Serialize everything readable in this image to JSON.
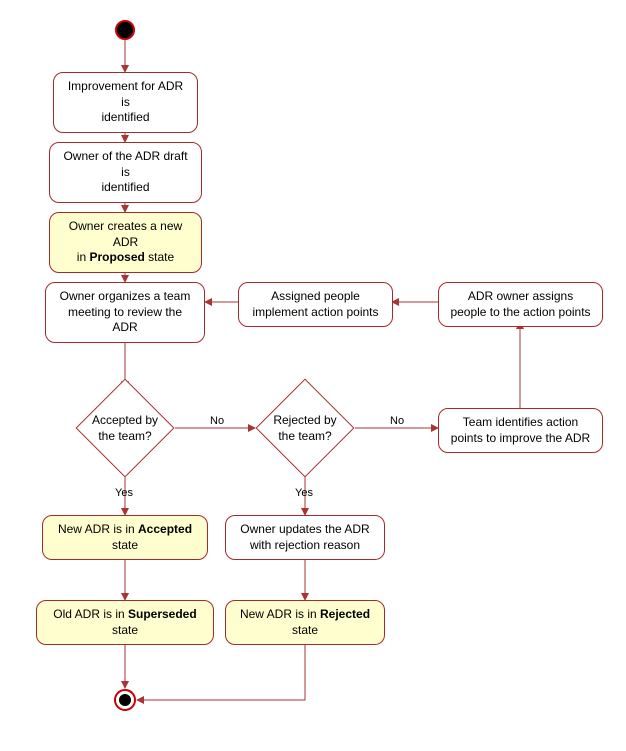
{
  "diagram": {
    "type": "activity",
    "start": true,
    "end": true,
    "nodes": {
      "n1": {
        "text_pre": "Improvement for ADR is",
        "text_post": "identified"
      },
      "n2": {
        "text_pre": "Owner of the ADR draft is",
        "text_post": "identified"
      },
      "n3": {
        "pre": "Owner creates a new ADR",
        "mid_pre": "in ",
        "bold": "Proposed",
        "mid_post": " state"
      },
      "n4": {
        "text_pre": "Owner organizes a team",
        "text_post": "meeting to review the ADR"
      },
      "d1": {
        "line1": "Accepted by",
        "line2": "the team?"
      },
      "d2": {
        "line1": "Rejected by",
        "line2": "the team?"
      },
      "n5": {
        "text_pre": "Team identifies action",
        "text_post": "points to improve the ADR"
      },
      "n6": {
        "text_pre": "ADR owner assigns",
        "text_post": "people to the action points"
      },
      "n7": {
        "text_pre": "Assigned people",
        "text_post": "implement action points"
      },
      "n8": {
        "pre": "New ADR is in ",
        "bold": "Accepted",
        "post": "state"
      },
      "n9": {
        "pre": "Old ADR is in ",
        "bold": "Superseded",
        "post": "state"
      },
      "n10": {
        "text_pre": "Owner updates the ADR",
        "text_post": "with rejection reason"
      },
      "n11": {
        "pre": "New ADR is in ",
        "bold": "Rejected",
        "post": "state"
      }
    },
    "edge_labels": {
      "d1_yes": "Yes",
      "d1_no": "No",
      "d2_yes": "Yes",
      "d2_no": "No"
    }
  },
  "chart_data": {
    "type": "activity-diagram",
    "title": "ADR lifecycle activity diagram",
    "start_node": "start",
    "end_node": "end",
    "nodes": [
      {
        "id": "start",
        "kind": "initial"
      },
      {
        "id": "n1",
        "kind": "action",
        "label": "Improvement for ADR is identified",
        "highlight": false
      },
      {
        "id": "n2",
        "kind": "action",
        "label": "Owner of the ADR draft is identified",
        "highlight": false
      },
      {
        "id": "n3",
        "kind": "action",
        "label": "Owner creates a new ADR in Proposed state",
        "highlight": true
      },
      {
        "id": "n4",
        "kind": "action",
        "label": "Owner organizes a team meeting to review the ADR",
        "highlight": false
      },
      {
        "id": "d1",
        "kind": "decision",
        "label": "Accepted by the team?"
      },
      {
        "id": "d2",
        "kind": "decision",
        "label": "Rejected by the team?"
      },
      {
        "id": "n5",
        "kind": "action",
        "label": "Team identifies action points to improve the ADR",
        "highlight": false
      },
      {
        "id": "n6",
        "kind": "action",
        "label": "ADR owner assigns people to the action points",
        "highlight": false
      },
      {
        "id": "n7",
        "kind": "action",
        "label": "Assigned people implement action points",
        "highlight": false
      },
      {
        "id": "n8",
        "kind": "action",
        "label": "New ADR is in Accepted state",
        "highlight": true
      },
      {
        "id": "n9",
        "kind": "action",
        "label": "Old ADR is in Superseded state",
        "highlight": true
      },
      {
        "id": "n10",
        "kind": "action",
        "label": "Owner updates the ADR with rejection reason",
        "highlight": false
      },
      {
        "id": "n11",
        "kind": "action",
        "label": "New ADR is in Rejected state",
        "highlight": true
      },
      {
        "id": "end",
        "kind": "final"
      }
    ],
    "edges": [
      {
        "from": "start",
        "to": "n1"
      },
      {
        "from": "n1",
        "to": "n2"
      },
      {
        "from": "n2",
        "to": "n3"
      },
      {
        "from": "n3",
        "to": "n4"
      },
      {
        "from": "n4",
        "to": "d1"
      },
      {
        "from": "d1",
        "to": "n8",
        "label": "Yes"
      },
      {
        "from": "d1",
        "to": "d2",
        "label": "No"
      },
      {
        "from": "d2",
        "to": "n10",
        "label": "Yes"
      },
      {
        "from": "d2",
        "to": "n5",
        "label": "No"
      },
      {
        "from": "n5",
        "to": "n6"
      },
      {
        "from": "n6",
        "to": "n7"
      },
      {
        "from": "n7",
        "to": "n4"
      },
      {
        "from": "n8",
        "to": "n9"
      },
      {
        "from": "n9",
        "to": "end"
      },
      {
        "from": "n10",
        "to": "n11"
      },
      {
        "from": "n11",
        "to": "end"
      }
    ]
  }
}
